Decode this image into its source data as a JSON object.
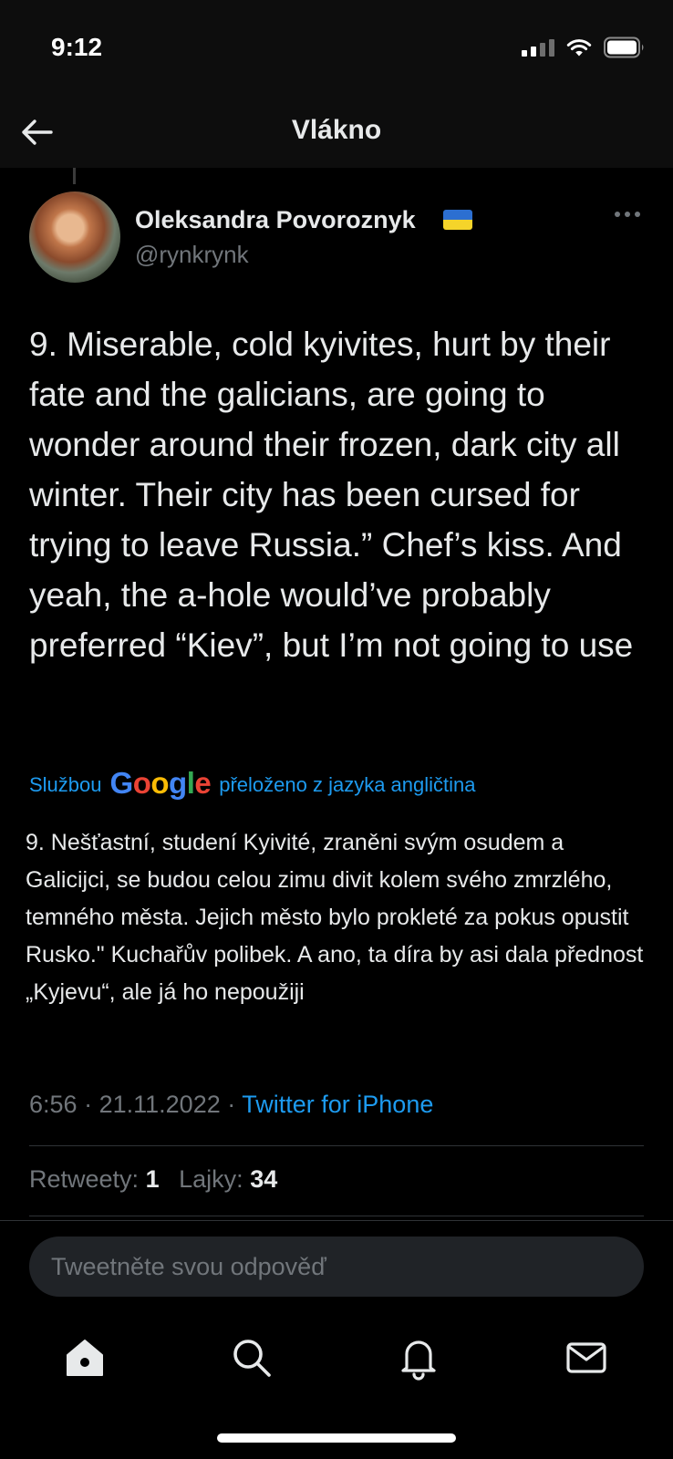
{
  "status_bar": {
    "time": "9:12"
  },
  "header": {
    "title": "Vlákno"
  },
  "tweet": {
    "display_name": "Oleksandra Povoroznyk",
    "handle": "@rynkrynk",
    "text": "9. Miserable, cold kyivites, hurt by their fate and the galicians, are going to wonder around their frozen, dark city all winter. Their city has been cursed for trying to leave Russia.” Chef’s kiss. And yeah, the a-hole would’ve probably preferred “Kiev”, but I’m not going to use",
    "translation": {
      "prefix": "Službou",
      "logo_text": "Google",
      "suffix": "přeloženo z jazyka angličtina",
      "text": "9. Nešťastní, studení Kyivité, zraněni svým osudem a Galicijci, se budou celou zimu divit kolem svého zmrzlého, temného města. Jejich město bylo prokleté za pokus opustit Rusko.\" Kuchařův polibek. A ano, ta díra by asi dala přednost „Kyjevu“, ale já ho nepoužiji"
    },
    "time": "6:56",
    "separator": "·",
    "date": "21.11.2022",
    "source": "Twitter for iPhone",
    "stats": {
      "retweets_label": "Retweety:",
      "retweets_count": "1",
      "likes_label": "Lajky:",
      "likes_count": "34"
    }
  },
  "reply_box": {
    "placeholder": "Tweetněte svou odpověď"
  },
  "tab_bar": {
    "icons": [
      "home-icon",
      "search-icon",
      "notifications-bell-icon",
      "messages-mail-icon"
    ]
  },
  "colors": {
    "accent": "#1d9bf0",
    "background": "#000000",
    "secondary_text": "#71767b"
  }
}
